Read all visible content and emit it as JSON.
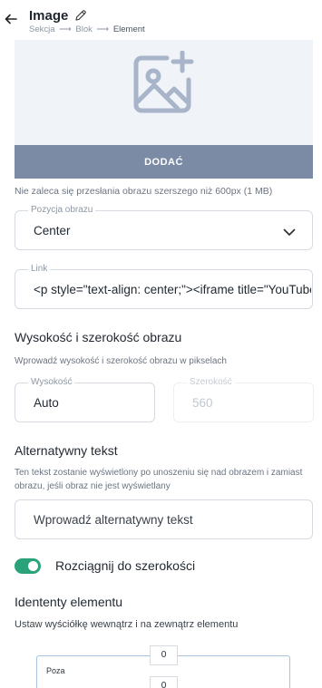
{
  "header": {
    "title": "Image",
    "breadcrumb": [
      "Sekcja",
      "Blok",
      "Element"
    ],
    "breadcrumb_arrow": "⟶"
  },
  "upload": {
    "button_label": "DODAĆ",
    "hint": "Nie zaleca się przesłania obrazu szerszego niż 600px (1 MB)"
  },
  "position": {
    "legend": "Pozycja obrazu",
    "value": "Center"
  },
  "link": {
    "legend": "Link",
    "value": "<p style=\"text-align: center;\"><iframe title=\"YouTube v"
  },
  "dimensions": {
    "title": "Wysokość i szerokość obrazu",
    "description": "Wprowadź wysokość i szerokość obrazu w pikselach",
    "height_legend": "Wysokość",
    "height_value": "Auto",
    "width_legend": "Szerokość",
    "width_value": "560"
  },
  "alt": {
    "title": "Alternatywny tekst",
    "description": "Ten tekst zostanie wyświetlony po unoszeniu się nad obrazem i zamiast obrazu, jeśli obraz nie jest wyświetlany",
    "placeholder": "Wprowadź alternatywny tekst"
  },
  "stretch": {
    "label": "Rozciągnij do szerokości",
    "enabled": true
  },
  "spacing": {
    "title": "Idententy elementu",
    "description": "Ustaw wyściółkę wewnątrz i na zewnątrz elementu",
    "outer_label": "Poza",
    "outer_top": "0",
    "inner_top": "0"
  },
  "colors": {
    "accent": "#2aa27a",
    "button": "#7b8ba6",
    "upload_bg": "#f0f4f9"
  }
}
